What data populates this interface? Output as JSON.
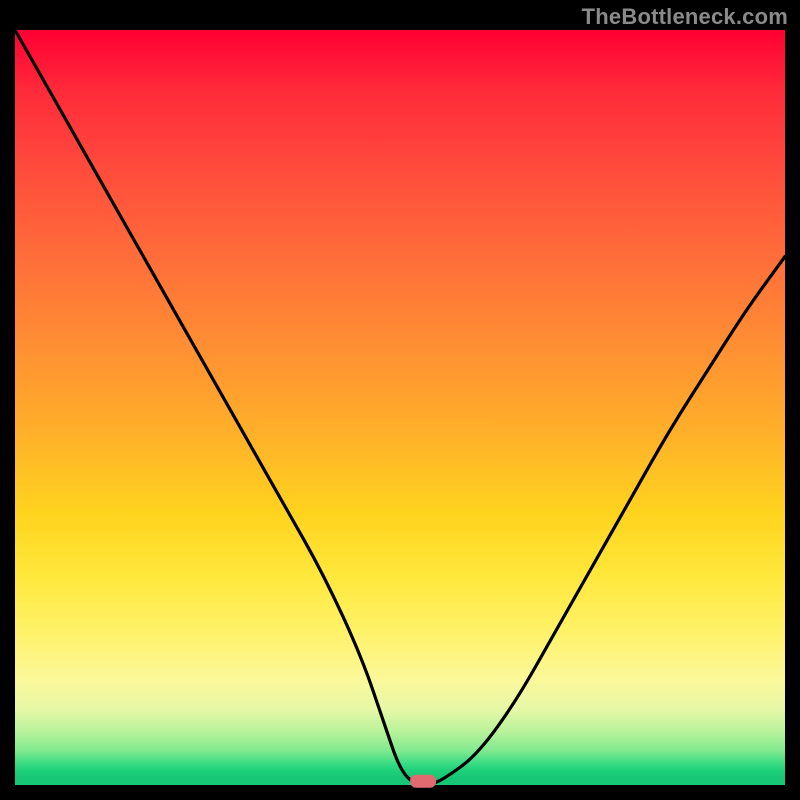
{
  "watermark": "TheBottleneck.com",
  "chart_data": {
    "type": "line",
    "title": "",
    "xlabel": "",
    "ylabel": "",
    "xlim": [
      0,
      100
    ],
    "ylim": [
      0,
      100
    ],
    "grid": false,
    "legend": false,
    "background_gradient": [
      {
        "pos": 0,
        "color": "#ff0033"
      },
      {
        "pos": 25,
        "color": "#ff6d3a"
      },
      {
        "pos": 50,
        "color": "#ffb229"
      },
      {
        "pos": 72,
        "color": "#fff26a"
      },
      {
        "pos": 90,
        "color": "#c6f49e"
      },
      {
        "pos": 100,
        "color": "#18c776"
      }
    ],
    "series": [
      {
        "name": "bottleneck-curve",
        "color": "#000000",
        "x": [
          0,
          5,
          10,
          15,
          20,
          25,
          30,
          35,
          40,
          45,
          48,
          50,
          52,
          54,
          56,
          60,
          65,
          70,
          75,
          80,
          85,
          90,
          95,
          100
        ],
        "y": [
          100,
          91,
          82,
          73,
          64,
          55,
          46,
          37,
          28,
          17,
          8,
          2,
          0,
          0,
          1,
          4,
          11,
          20,
          29,
          38,
          47,
          55,
          63,
          70
        ]
      }
    ],
    "marker": {
      "name": "optimal-marker",
      "x": 53,
      "y": 0.5,
      "color": "#e06a6f",
      "shape": "pill"
    }
  }
}
